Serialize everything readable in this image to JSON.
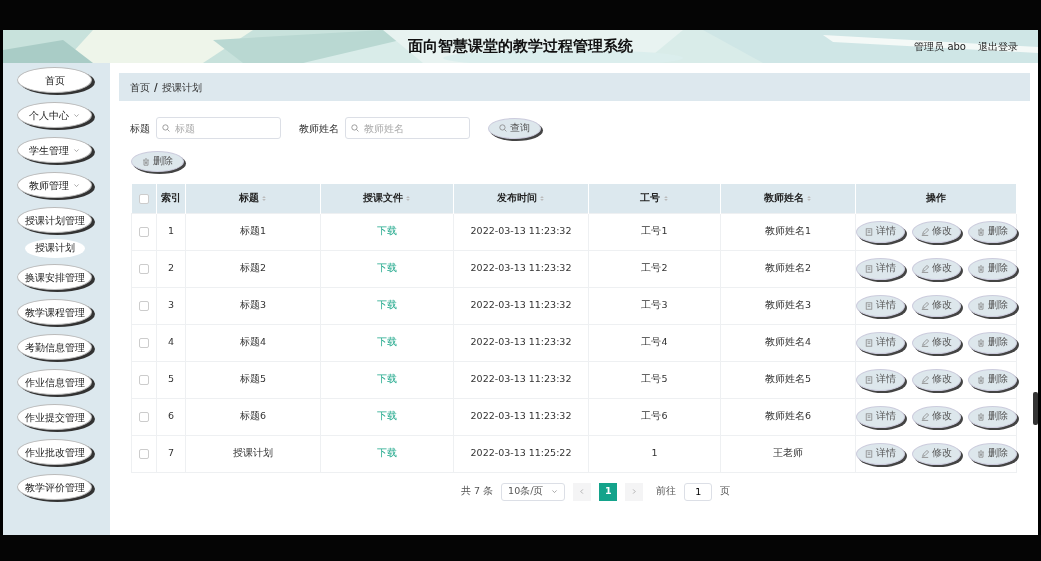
{
  "header": {
    "title": "面向智慧课堂的教学过程管理系统",
    "user": "管理员 abo",
    "logout": "退出登录"
  },
  "sidebar": {
    "items": [
      {
        "label": "首页",
        "kind": "link"
      },
      {
        "label": "个人中心",
        "kind": "group",
        "expanded": false
      },
      {
        "label": "学生管理",
        "kind": "group",
        "expanded": false
      },
      {
        "label": "教师管理",
        "kind": "group",
        "expanded": false
      },
      {
        "label": "授课计划管理",
        "kind": "group",
        "expanded": true,
        "children": [
          {
            "label": "授课计划",
            "kind": "link"
          }
        ]
      },
      {
        "label": "换课安排管理",
        "kind": "link"
      },
      {
        "label": "教学课程管理",
        "kind": "link"
      },
      {
        "label": "考勤信息管理",
        "kind": "link"
      },
      {
        "label": "作业信息管理",
        "kind": "link"
      },
      {
        "label": "作业提交管理",
        "kind": "link"
      },
      {
        "label": "作业批改管理",
        "kind": "link"
      },
      {
        "label": "教学评价管理",
        "kind": "link"
      }
    ]
  },
  "breadcrumb": {
    "items": [
      "首页",
      "授课计划"
    ],
    "separator": "/"
  },
  "search": {
    "fields": [
      {
        "label": "标题",
        "placeholder": "标题"
      },
      {
        "label": "教师姓名",
        "placeholder": "教师姓名"
      }
    ],
    "button": "查询"
  },
  "delete_button": "删除",
  "table": {
    "select_all_checked": false,
    "columns": [
      {
        "label": "索引",
        "sortable": false,
        "kind": "text"
      },
      {
        "label": "标题",
        "sortable": true,
        "kind": "text"
      },
      {
        "label": "授课文件",
        "sortable": true,
        "kind": "link"
      },
      {
        "label": "发布时间",
        "sortable": true,
        "kind": "text"
      },
      {
        "label": "工号",
        "sortable": true,
        "kind": "text"
      },
      {
        "label": "教师姓名",
        "sortable": true,
        "kind": "text"
      },
      {
        "label": "操作",
        "sortable": false,
        "kind": "actions"
      }
    ],
    "rows": [
      {
        "checked": false,
        "cells": [
          "1",
          "标题1",
          "下载",
          "2022-03-13 11:23:32",
          "工号1",
          "教师姓名1"
        ],
        "actions": [
          {
            "label": "详情",
            "kind": "view"
          },
          {
            "label": "修改",
            "kind": "edit"
          },
          {
            "label": "删除",
            "kind": "delete"
          }
        ]
      },
      {
        "checked": false,
        "cells": [
          "2",
          "标题2",
          "下载",
          "2022-03-13 11:23:32",
          "工号2",
          "教师姓名2"
        ],
        "actions": [
          {
            "label": "详情",
            "kind": "view"
          },
          {
            "label": "修改",
            "kind": "edit"
          },
          {
            "label": "删除",
            "kind": "delete"
          }
        ]
      },
      {
        "checked": false,
        "cells": [
          "3",
          "标题3",
          "下载",
          "2022-03-13 11:23:32",
          "工号3",
          "教师姓名3"
        ],
        "actions": [
          {
            "label": "详情",
            "kind": "view"
          },
          {
            "label": "修改",
            "kind": "edit"
          },
          {
            "label": "删除",
            "kind": "delete"
          }
        ]
      },
      {
        "checked": false,
        "cells": [
          "4",
          "标题4",
          "下载",
          "2022-03-13 11:23:32",
          "工号4",
          "教师姓名4"
        ],
        "actions": [
          {
            "label": "详情",
            "kind": "view"
          },
          {
            "label": "修改",
            "kind": "edit"
          },
          {
            "label": "删除",
            "kind": "delete"
          }
        ]
      },
      {
        "checked": false,
        "cells": [
          "5",
          "标题5",
          "下载",
          "2022-03-13 11:23:32",
          "工号5",
          "教师姓名5"
        ],
        "actions": [
          {
            "label": "详情",
            "kind": "view"
          },
          {
            "label": "修改",
            "kind": "edit"
          },
          {
            "label": "删除",
            "kind": "delete"
          }
        ]
      },
      {
        "checked": false,
        "cells": [
          "6",
          "标题6",
          "下载",
          "2022-03-13 11:23:32",
          "工号6",
          "教师姓名6"
        ],
        "actions": [
          {
            "label": "详情",
            "kind": "view"
          },
          {
            "label": "修改",
            "kind": "edit"
          },
          {
            "label": "删除",
            "kind": "delete"
          }
        ]
      },
      {
        "checked": false,
        "cells": [
          "7",
          "授课计划",
          "下载",
          "2022-03-13 11:25:22",
          "1",
          "王老师"
        ],
        "actions": [
          {
            "label": "详情",
            "kind": "view"
          },
          {
            "label": "修改",
            "kind": "edit"
          },
          {
            "label": "删除",
            "kind": "delete"
          }
        ]
      }
    ]
  },
  "pagination": {
    "total": "共 7 条",
    "page_size": "10条/页",
    "pages": [
      {
        "label": "1",
        "selected": true
      }
    ],
    "goto_label": "前往",
    "goto_value": "1",
    "page_suffix": "页"
  }
}
